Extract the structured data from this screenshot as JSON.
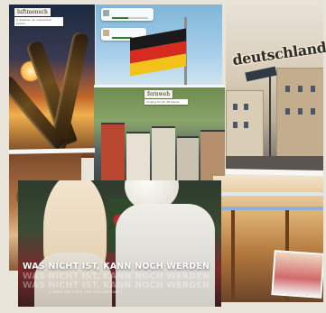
{
  "collage": {
    "tiles": [
      {
        "name": "sunset-bottles-photo"
      },
      {
        "name": "german-flag-photo"
      },
      {
        "name": "deutschland-street-photo"
      },
      {
        "name": "food-photo"
      },
      {
        "name": "fernweh-town-photo"
      },
      {
        "name": "oktoberfest-photo"
      },
      {
        "name": "couple-photo"
      }
    ],
    "notes": {
      "luftmensch": "luftmensch",
      "luftmensch_caption": "a dreamer; an impractical person",
      "fernweh": "fernweh",
      "fernweh_caption": "longing for far-off places",
      "deutschland": "deutschland"
    },
    "quote": {
      "main": "WAS NICHT IST, KANN NOCH WERDEN",
      "echo1": "WAS NICHT IST, KANN NOCH WERDEN",
      "echo2": "WAS NICHT IST, KANN NOCH WERDEN",
      "sub": "( WHAT ISN'T YET, CAN STILL BECOME )"
    }
  },
  "colors": {
    "flag_black": "#1a1a1a",
    "flag_red": "#d62b1f",
    "flag_gold": "#f2c21b",
    "paper": "#f6f2e6"
  }
}
